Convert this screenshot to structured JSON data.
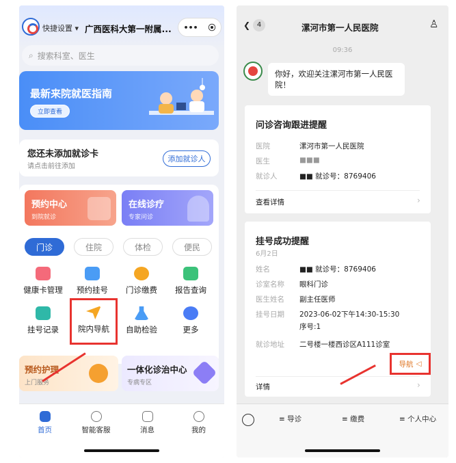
{
  "left": {
    "quick": "快捷设置",
    "hospital": "广西医科大第一附属...",
    "capsule_more": "•••",
    "capsule_close": "⦿",
    "search_placeholder": "搜索科室、医生",
    "banner": {
      "title": "最新来院就医指南",
      "button": "立即查看"
    },
    "card": {
      "title": "您还未添加就诊卡",
      "sub": "请点击前往添加",
      "button": "添加就诊人"
    },
    "big": [
      {
        "title": "预约中心",
        "sub": "到院就诊"
      },
      {
        "title": "在线诊疗",
        "sub": "专家问诊"
      }
    ],
    "tabs": [
      "门诊",
      "住院",
      "体检",
      "便民"
    ],
    "icons": [
      "健康卡管理",
      "预约挂号",
      "门诊缴费",
      "报告查询",
      "挂号记录",
      "院内导航",
      "自助检验",
      "更多"
    ],
    "promo": [
      {
        "title": "预约护理",
        "sub": "上门服务"
      },
      {
        "title": "一体化诊治中心",
        "sub": "专病专区"
      }
    ],
    "nav": [
      "首页",
      "智能客服",
      "消息",
      "我的"
    ],
    "colors": {
      "accent": "#2f6bd6",
      "highlight": "#e8332f"
    }
  },
  "right": {
    "unread": "4",
    "title": "漯河市第一人民医院",
    "time": "09:36",
    "greeting": "你好，欢迎关注漯河市第一人民医院！",
    "card1": {
      "title": "问诊咨询跟进提醒",
      "rows": [
        {
          "k": "医院",
          "v": "漯河市第一人民医院"
        },
        {
          "k": "医生",
          "v": "■■■"
        },
        {
          "k": "就诊人",
          "v": "■■  就诊号：8769406"
        }
      ],
      "link": "查看详情"
    },
    "card2": {
      "title": "挂号成功提醒",
      "date": "6月2日",
      "rows": [
        {
          "k": "姓名",
          "v": "■■  就诊号：8769406"
        },
        {
          "k": "诊室名称",
          "v": "眼科门诊"
        },
        {
          "k": "医生姓名",
          "v": "副主任医师"
        },
        {
          "k": "挂号日期",
          "v": "2023-06-02下午14:30-15:30"
        },
        {
          "k": "",
          "v": "序号:1"
        },
        {
          "k": "就诊地址",
          "v": "二号楼一楼西诊区A111诊室"
        }
      ],
      "nav_btn": "导航",
      "link": "详情"
    },
    "nav": [
      "导诊",
      "缴费",
      "个人中心"
    ]
  }
}
